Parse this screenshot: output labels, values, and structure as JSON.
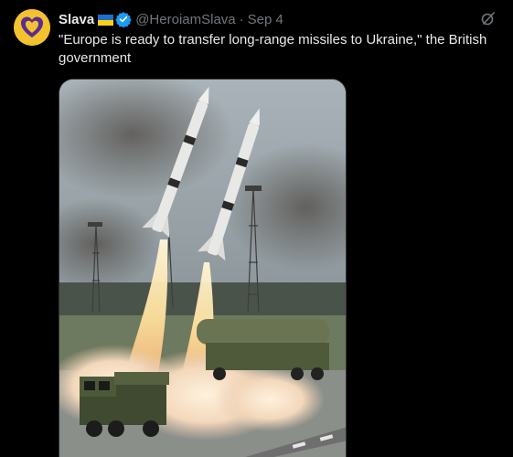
{
  "author": {
    "display_name": "Slava",
    "flag_emoji": "ukraine-flag-icon",
    "verified_icon": "verified-badge-icon",
    "handle": "@HeroiamSlava",
    "separator": "·",
    "date": "Sep 4"
  },
  "tweet": {
    "text": "\"Europe is ready to transfer long-range missiles to Ukraine,\" the British government"
  },
  "icons": {
    "avatar": "heart-logo-avatar",
    "grok": "grok-icon"
  },
  "media": {
    "type": "image",
    "alt_description": "missile-launch-photo"
  },
  "colors": {
    "background": "#000000",
    "text_primary": "#e7e9ea",
    "text_secondary": "#71767b",
    "verified_blue": "#1d9bf0",
    "avatar_yellow": "#f2c230",
    "avatar_purple": "#5b2d8e"
  }
}
